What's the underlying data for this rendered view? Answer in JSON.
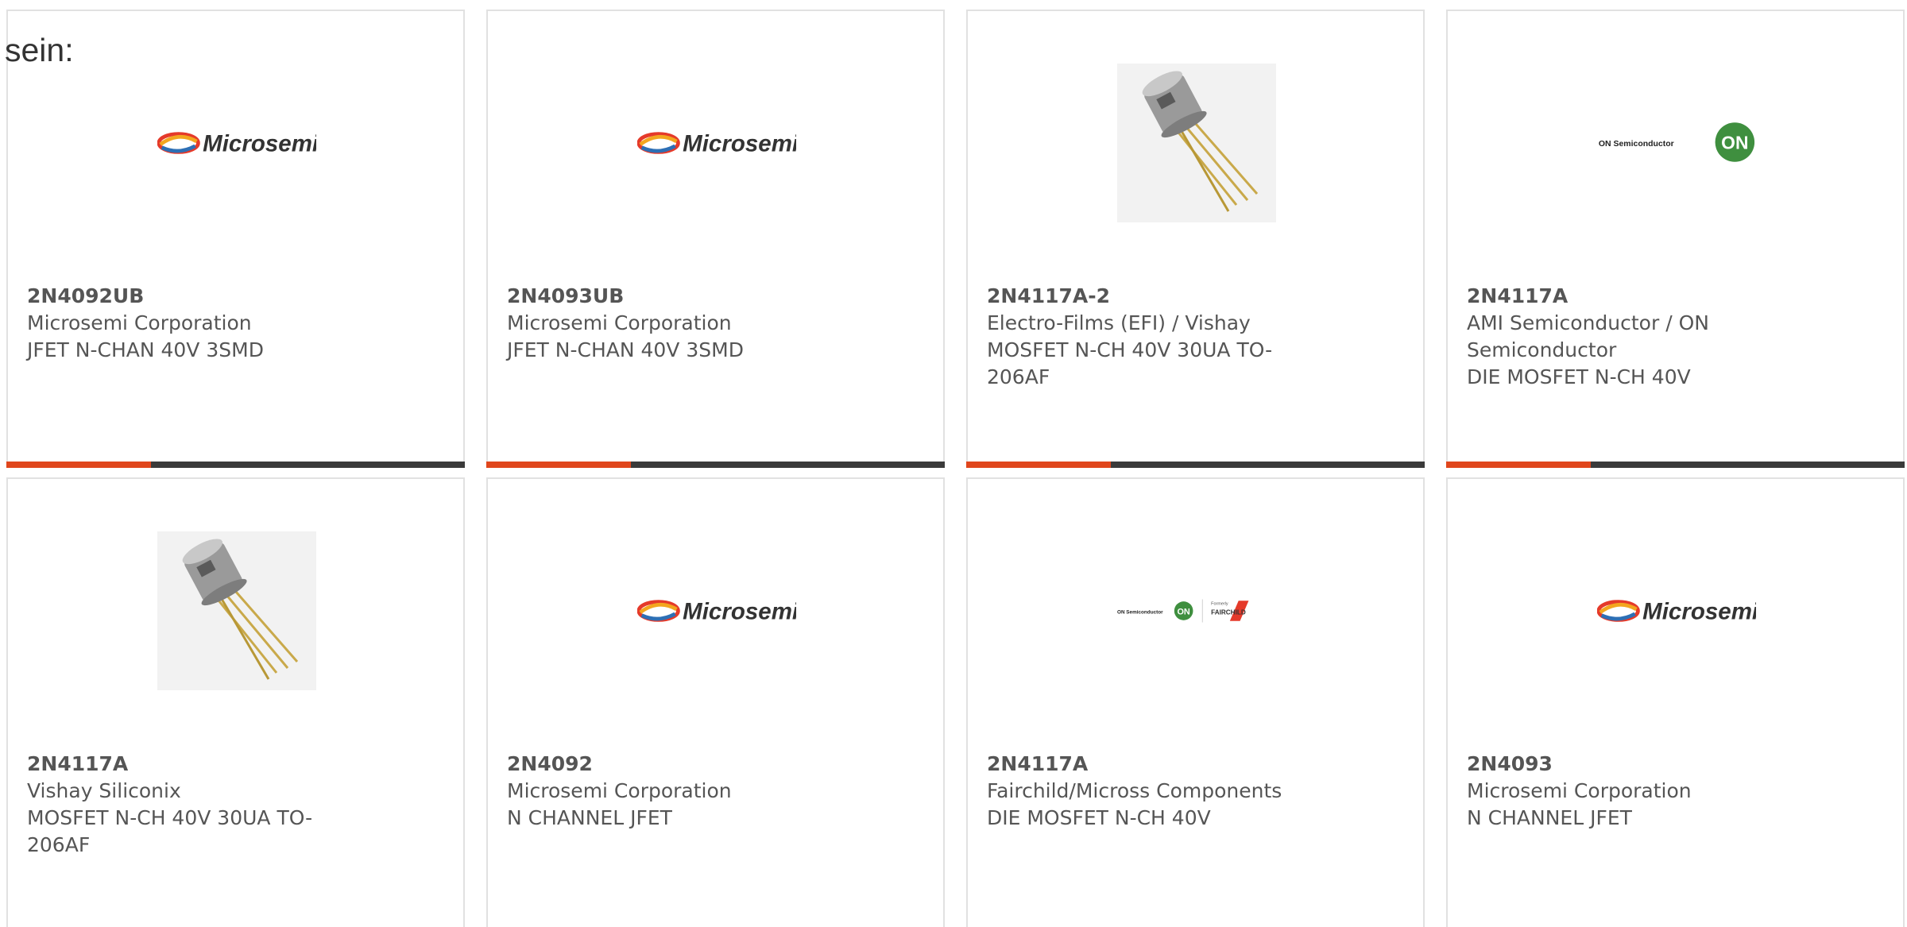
{
  "intro_text": "sein:",
  "cards": [
    {
      "part_number": "2N4092UB",
      "manufacturer": "Microsemi Corporation",
      "description": "JFET N-CHAN 40V 3SMD",
      "image": "microsemi-logo",
      "logo_text": "Microsemi"
    },
    {
      "part_number": "2N4093UB",
      "manufacturer": "Microsemi Corporation",
      "description": "JFET N-CHAN 40V 3SMD",
      "image": "microsemi-logo",
      "logo_text": "Microsemi"
    },
    {
      "part_number": "2N4117A-2",
      "manufacturer": "Electro-Films (EFI) / Vishay",
      "description": "MOSFET N-CH 40V 30UA TO-206AF",
      "image": "transistor-photo"
    },
    {
      "part_number": "2N4117A",
      "manufacturer": "AMI Semiconductor / ON Semiconductor",
      "description": "DIE MOSFET N-CH 40V",
      "image": "on-semiconductor-logo",
      "logo_text": "ON Semiconductor",
      "logo_badge": "ON"
    },
    {
      "part_number": "2N4117A",
      "manufacturer": "Vishay Siliconix",
      "description": "MOSFET N-CH 40V 30UA TO-206AF",
      "image": "transistor-photo"
    },
    {
      "part_number": "2N4092",
      "manufacturer": "Microsemi Corporation",
      "description": "N CHANNEL JFET",
      "image": "microsemi-logo",
      "logo_text": "Microsemi"
    },
    {
      "part_number": "2N4117A",
      "manufacturer": "Fairchild/Micross Components",
      "description": "DIE MOSFET N-CH 40V",
      "image": "on-fairchild-logo",
      "logo_text": "ON Semiconductor",
      "logo_badge": "ON",
      "logo_formerly": "Formerly",
      "logo_fairchild": "FAIRCHILD"
    },
    {
      "part_number": "2N4093",
      "manufacturer": "Microsemi Corporation",
      "description": "N CHANNEL JFET",
      "image": "microsemi-logo",
      "logo_text": "Microsemi"
    }
  ],
  "colors": {
    "accent": "#e0461c",
    "bar": "#3a3a3a",
    "border": "#e1e1e1",
    "text": "#555555",
    "on_green": "#3f8f3f"
  }
}
